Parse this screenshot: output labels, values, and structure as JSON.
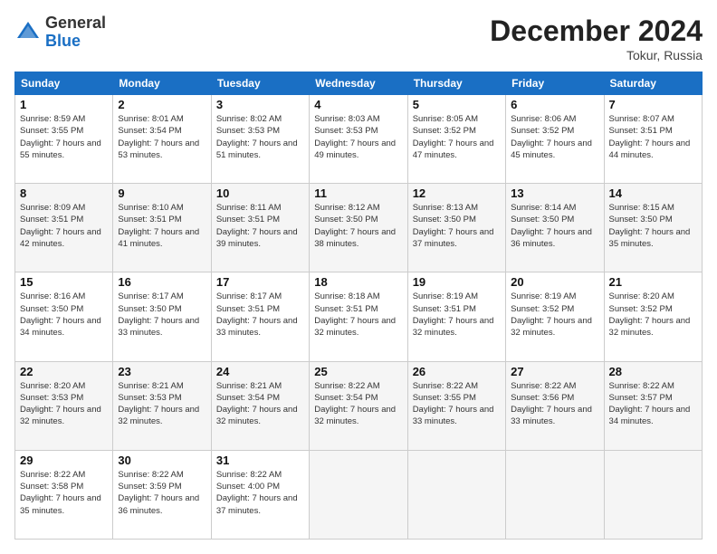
{
  "header": {
    "logo_general": "General",
    "logo_blue": "Blue",
    "month_year": "December 2024",
    "location": "Tokur, Russia"
  },
  "weekdays": [
    "Sunday",
    "Monday",
    "Tuesday",
    "Wednesday",
    "Thursday",
    "Friday",
    "Saturday"
  ],
  "weeks": [
    [
      {
        "day": "1",
        "sunrise": "8:59 AM",
        "sunset": "3:55 PM",
        "daylight": "7 hours and 55 minutes."
      },
      {
        "day": "2",
        "sunrise": "8:01 AM",
        "sunset": "3:54 PM",
        "daylight": "7 hours and 53 minutes."
      },
      {
        "day": "3",
        "sunrise": "8:02 AM",
        "sunset": "3:53 PM",
        "daylight": "7 hours and 51 minutes."
      },
      {
        "day": "4",
        "sunrise": "8:03 AM",
        "sunset": "3:53 PM",
        "daylight": "7 hours and 49 minutes."
      },
      {
        "day": "5",
        "sunrise": "8:05 AM",
        "sunset": "3:52 PM",
        "daylight": "7 hours and 47 minutes."
      },
      {
        "day": "6",
        "sunrise": "8:06 AM",
        "sunset": "3:52 PM",
        "daylight": "7 hours and 45 minutes."
      },
      {
        "day": "7",
        "sunrise": "8:07 AM",
        "sunset": "3:51 PM",
        "daylight": "7 hours and 44 minutes."
      }
    ],
    [
      {
        "day": "8",
        "sunrise": "8:09 AM",
        "sunset": "3:51 PM",
        "daylight": "7 hours and 42 minutes."
      },
      {
        "day": "9",
        "sunrise": "8:10 AM",
        "sunset": "3:51 PM",
        "daylight": "7 hours and 41 minutes."
      },
      {
        "day": "10",
        "sunrise": "8:11 AM",
        "sunset": "3:51 PM",
        "daylight": "7 hours and 39 minutes."
      },
      {
        "day": "11",
        "sunrise": "8:12 AM",
        "sunset": "3:50 PM",
        "daylight": "7 hours and 38 minutes."
      },
      {
        "day": "12",
        "sunrise": "8:13 AM",
        "sunset": "3:50 PM",
        "daylight": "7 hours and 37 minutes."
      },
      {
        "day": "13",
        "sunrise": "8:14 AM",
        "sunset": "3:50 PM",
        "daylight": "7 hours and 36 minutes."
      },
      {
        "day": "14",
        "sunrise": "8:15 AM",
        "sunset": "3:50 PM",
        "daylight": "7 hours and 35 minutes."
      }
    ],
    [
      {
        "day": "15",
        "sunrise": "8:16 AM",
        "sunset": "3:50 PM",
        "daylight": "7 hours and 34 minutes."
      },
      {
        "day": "16",
        "sunrise": "8:17 AM",
        "sunset": "3:50 PM",
        "daylight": "7 hours and 33 minutes."
      },
      {
        "day": "17",
        "sunrise": "8:17 AM",
        "sunset": "3:51 PM",
        "daylight": "7 hours and 33 minutes."
      },
      {
        "day": "18",
        "sunrise": "8:18 AM",
        "sunset": "3:51 PM",
        "daylight": "7 hours and 32 minutes."
      },
      {
        "day": "19",
        "sunrise": "8:19 AM",
        "sunset": "3:51 PM",
        "daylight": "7 hours and 32 minutes."
      },
      {
        "day": "20",
        "sunrise": "8:19 AM",
        "sunset": "3:52 PM",
        "daylight": "7 hours and 32 minutes."
      },
      {
        "day": "21",
        "sunrise": "8:20 AM",
        "sunset": "3:52 PM",
        "daylight": "7 hours and 32 minutes."
      }
    ],
    [
      {
        "day": "22",
        "sunrise": "8:20 AM",
        "sunset": "3:53 PM",
        "daylight": "7 hours and 32 minutes."
      },
      {
        "day": "23",
        "sunrise": "8:21 AM",
        "sunset": "3:53 PM",
        "daylight": "7 hours and 32 minutes."
      },
      {
        "day": "24",
        "sunrise": "8:21 AM",
        "sunset": "3:54 PM",
        "daylight": "7 hours and 32 minutes."
      },
      {
        "day": "25",
        "sunrise": "8:22 AM",
        "sunset": "3:54 PM",
        "daylight": "7 hours and 32 minutes."
      },
      {
        "day": "26",
        "sunrise": "8:22 AM",
        "sunset": "3:55 PM",
        "daylight": "7 hours and 33 minutes."
      },
      {
        "day": "27",
        "sunrise": "8:22 AM",
        "sunset": "3:56 PM",
        "daylight": "7 hours and 33 minutes."
      },
      {
        "day": "28",
        "sunrise": "8:22 AM",
        "sunset": "3:57 PM",
        "daylight": "7 hours and 34 minutes."
      }
    ],
    [
      {
        "day": "29",
        "sunrise": "8:22 AM",
        "sunset": "3:58 PM",
        "daylight": "7 hours and 35 minutes."
      },
      {
        "day": "30",
        "sunrise": "8:22 AM",
        "sunset": "3:59 PM",
        "daylight": "7 hours and 36 minutes."
      },
      {
        "day": "31",
        "sunrise": "8:22 AM",
        "sunset": "4:00 PM",
        "daylight": "7 hours and 37 minutes."
      },
      null,
      null,
      null,
      null
    ]
  ]
}
